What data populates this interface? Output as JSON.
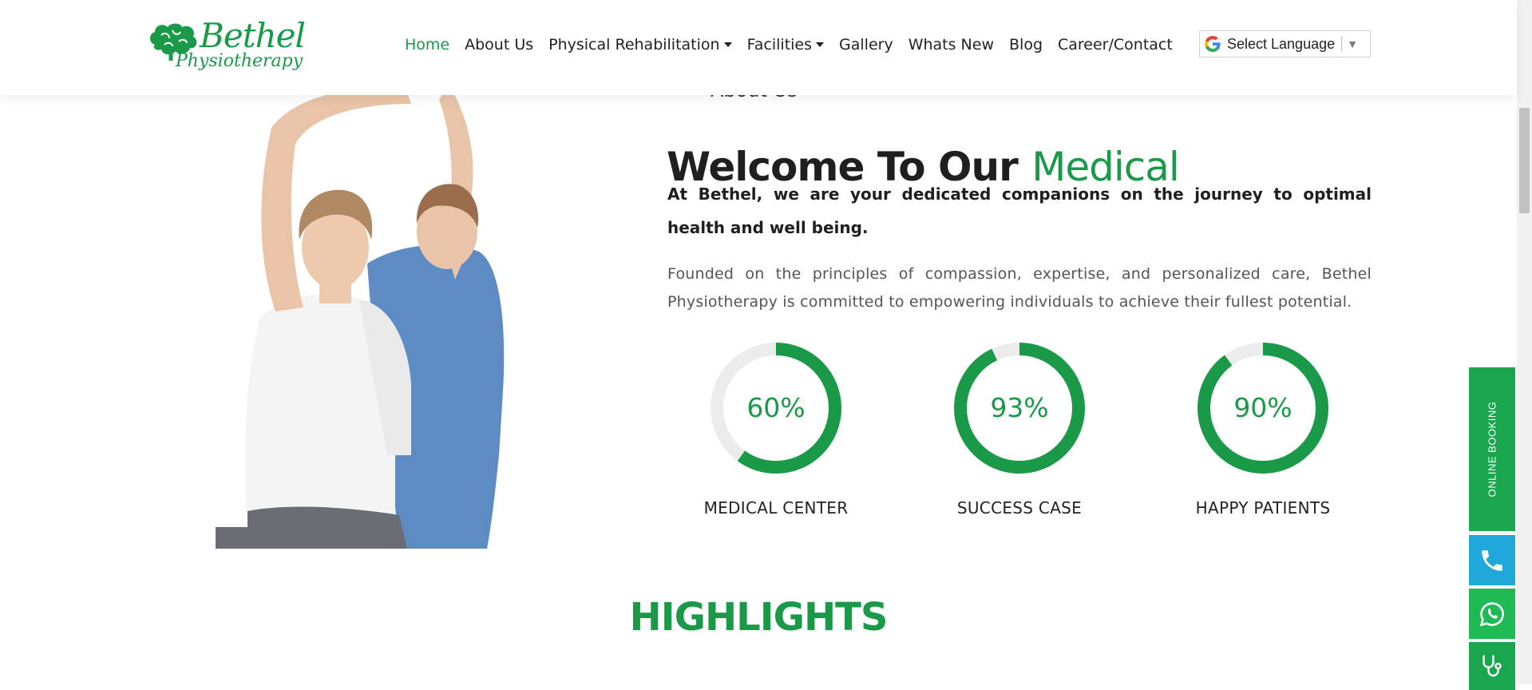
{
  "header": {
    "logo": {
      "name": "Bethel",
      "subtitle": "Physiotherapy"
    },
    "nav": [
      {
        "label": "Home",
        "active": true,
        "dropdown": false
      },
      {
        "label": "About Us",
        "active": false,
        "dropdown": false
      },
      {
        "label": "Physical Rehabilitation",
        "active": false,
        "dropdown": true
      },
      {
        "label": "Facilities",
        "active": false,
        "dropdown": true
      },
      {
        "label": "Gallery",
        "active": false,
        "dropdown": false
      },
      {
        "label": "Whats New",
        "active": false,
        "dropdown": false
      },
      {
        "label": "Blog",
        "active": false,
        "dropdown": false
      },
      {
        "label": "Career/Contact",
        "active": false,
        "dropdown": false
      }
    ],
    "language": {
      "label": "Select Language",
      "icon": "google-g-icon"
    }
  },
  "about": {
    "eyebrow": "About Us",
    "title_dark": "Welcome To Our",
    "title_green": "Medical",
    "lead": "At Bethel, we are your dedicated companions on the journey to optimal health and well being.",
    "description": "Founded on the principles of compassion, expertise, and personalized care, Bethel Physiotherapy is committed to empowering individuals to achieve their fullest potential."
  },
  "stats": [
    {
      "value": "60%",
      "percent": 60,
      "label": "MEDICAL CENTER"
    },
    {
      "value": "93%",
      "percent": 93,
      "label": "SUCCESS CASE"
    },
    {
      "value": "90%",
      "percent": 90,
      "label": "HAPPY PATIENTS"
    }
  ],
  "highlights": {
    "title": "HIGHLIGHTS"
  },
  "side_buttons": {
    "booking": "ONLINE BOOKING",
    "phone_icon": "phone-icon",
    "whatsapp_icon": "whatsapp-icon",
    "stethoscope_icon": "stethoscope-icon"
  },
  "colors": {
    "brand_green": "#1a9a48",
    "ring_track": "#ececec",
    "phone_blue": "#1fa9d8",
    "whatsapp_green": "#1fba54"
  }
}
